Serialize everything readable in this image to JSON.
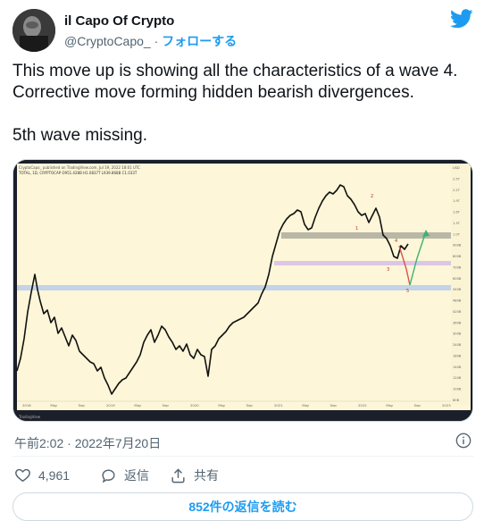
{
  "header": {
    "display_name": "il Capo Of Crypto",
    "handle": "@CryptoCapo_",
    "separator": "·",
    "follow_label": "フォローする"
  },
  "tweet": {
    "line1": "This move up is showing all the characteristics of a wave 4.",
    "line2": "Corrective move forming hidden bearish divergences.",
    "line3": "5th wave missing."
  },
  "chart": {
    "header_line1": "CryptoCapo_ published on TradingView.com, Jul 19, 2022 18:01 UTC",
    "header_line2": "TOTAL, 1D, CRYPTOCAP  O951.428B  H1.0837T  L939.868B  C1.033T",
    "wave_labels": [
      "1",
      "2",
      "3",
      "4",
      "5"
    ],
    "x_labels": [
      "2018",
      "May",
      "Sep",
      "2019",
      "May",
      "Sep",
      "2020",
      "May",
      "Sep",
      "2021",
      "May",
      "Sep",
      "2022",
      "May",
      "Sep",
      "2023"
    ],
    "y_labels": [
      "USD",
      "2.5T",
      "2.2T",
      "1.9T",
      "1.6T",
      "1.3T",
      "1.0T",
      "900B",
      "800B",
      "700B",
      "600B",
      "540B",
      "480B",
      "420B",
      "360B",
      "300B",
      "240B",
      "180B",
      "140B",
      "120B",
      "100B",
      "80B"
    ],
    "footer": "TradingView",
    "colors": {
      "background": "#fdf6d8",
      "resistance_band": "#b9b7a6",
      "support_band_pink": "#dcc6e6",
      "support_band_blue": "#c3d3e8",
      "arrow_up": "#3cb371",
      "arrow_down": "#d9534f"
    }
  },
  "meta": {
    "timestamp": "午前2:02 · 2022年7月20日"
  },
  "actions": {
    "likes_count": "4,961",
    "reply_label": "返信",
    "share_label": "共有"
  },
  "replies_button": "852件の返信を読む",
  "icons": {
    "brand": "twitter-bird-icon",
    "info": "info-icon",
    "like": "heart-icon",
    "reply": "reply-icon",
    "share": "share-icon"
  }
}
